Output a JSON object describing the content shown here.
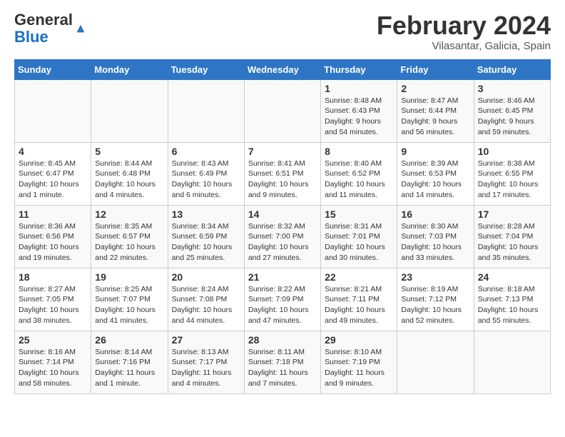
{
  "header": {
    "logo_general": "General",
    "logo_blue": "Blue",
    "title": "February 2024",
    "subtitle": "Vilasantar, Galicia, Spain"
  },
  "days_of_week": [
    "Sunday",
    "Monday",
    "Tuesday",
    "Wednesday",
    "Thursday",
    "Friday",
    "Saturday"
  ],
  "weeks": [
    [
      {
        "num": "",
        "info": ""
      },
      {
        "num": "",
        "info": ""
      },
      {
        "num": "",
        "info": ""
      },
      {
        "num": "",
        "info": ""
      },
      {
        "num": "1",
        "info": "Sunrise: 8:48 AM\nSunset: 6:43 PM\nDaylight: 9 hours\nand 54 minutes."
      },
      {
        "num": "2",
        "info": "Sunrise: 8:47 AM\nSunset: 6:44 PM\nDaylight: 9 hours\nand 56 minutes."
      },
      {
        "num": "3",
        "info": "Sunrise: 8:46 AM\nSunset: 6:45 PM\nDaylight: 9 hours\nand 59 minutes."
      }
    ],
    [
      {
        "num": "4",
        "info": "Sunrise: 8:45 AM\nSunset: 6:47 PM\nDaylight: 10 hours\nand 1 minute."
      },
      {
        "num": "5",
        "info": "Sunrise: 8:44 AM\nSunset: 6:48 PM\nDaylight: 10 hours\nand 4 minutes."
      },
      {
        "num": "6",
        "info": "Sunrise: 8:43 AM\nSunset: 6:49 PM\nDaylight: 10 hours\nand 6 minutes."
      },
      {
        "num": "7",
        "info": "Sunrise: 8:41 AM\nSunset: 6:51 PM\nDaylight: 10 hours\nand 9 minutes."
      },
      {
        "num": "8",
        "info": "Sunrise: 8:40 AM\nSunset: 6:52 PM\nDaylight: 10 hours\nand 11 minutes."
      },
      {
        "num": "9",
        "info": "Sunrise: 8:39 AM\nSunset: 6:53 PM\nDaylight: 10 hours\nand 14 minutes."
      },
      {
        "num": "10",
        "info": "Sunrise: 8:38 AM\nSunset: 6:55 PM\nDaylight: 10 hours\nand 17 minutes."
      }
    ],
    [
      {
        "num": "11",
        "info": "Sunrise: 8:36 AM\nSunset: 6:56 PM\nDaylight: 10 hours\nand 19 minutes."
      },
      {
        "num": "12",
        "info": "Sunrise: 8:35 AM\nSunset: 6:57 PM\nDaylight: 10 hours\nand 22 minutes."
      },
      {
        "num": "13",
        "info": "Sunrise: 8:34 AM\nSunset: 6:59 PM\nDaylight: 10 hours\nand 25 minutes."
      },
      {
        "num": "14",
        "info": "Sunrise: 8:32 AM\nSunset: 7:00 PM\nDaylight: 10 hours\nand 27 minutes."
      },
      {
        "num": "15",
        "info": "Sunrise: 8:31 AM\nSunset: 7:01 PM\nDaylight: 10 hours\nand 30 minutes."
      },
      {
        "num": "16",
        "info": "Sunrise: 8:30 AM\nSunset: 7:03 PM\nDaylight: 10 hours\nand 33 minutes."
      },
      {
        "num": "17",
        "info": "Sunrise: 8:28 AM\nSunset: 7:04 PM\nDaylight: 10 hours\nand 35 minutes."
      }
    ],
    [
      {
        "num": "18",
        "info": "Sunrise: 8:27 AM\nSunset: 7:05 PM\nDaylight: 10 hours\nand 38 minutes."
      },
      {
        "num": "19",
        "info": "Sunrise: 8:25 AM\nSunset: 7:07 PM\nDaylight: 10 hours\nand 41 minutes."
      },
      {
        "num": "20",
        "info": "Sunrise: 8:24 AM\nSunset: 7:08 PM\nDaylight: 10 hours\nand 44 minutes."
      },
      {
        "num": "21",
        "info": "Sunrise: 8:22 AM\nSunset: 7:09 PM\nDaylight: 10 hours\nand 47 minutes."
      },
      {
        "num": "22",
        "info": "Sunrise: 8:21 AM\nSunset: 7:11 PM\nDaylight: 10 hours\nand 49 minutes."
      },
      {
        "num": "23",
        "info": "Sunrise: 8:19 AM\nSunset: 7:12 PM\nDaylight: 10 hours\nand 52 minutes."
      },
      {
        "num": "24",
        "info": "Sunrise: 8:18 AM\nSunset: 7:13 PM\nDaylight: 10 hours\nand 55 minutes."
      }
    ],
    [
      {
        "num": "25",
        "info": "Sunrise: 8:16 AM\nSunset: 7:14 PM\nDaylight: 10 hours\nand 58 minutes."
      },
      {
        "num": "26",
        "info": "Sunrise: 8:14 AM\nSunset: 7:16 PM\nDaylight: 11 hours\nand 1 minute."
      },
      {
        "num": "27",
        "info": "Sunrise: 8:13 AM\nSunset: 7:17 PM\nDaylight: 11 hours\nand 4 minutes."
      },
      {
        "num": "28",
        "info": "Sunrise: 8:11 AM\nSunset: 7:18 PM\nDaylight: 11 hours\nand 7 minutes."
      },
      {
        "num": "29",
        "info": "Sunrise: 8:10 AM\nSunset: 7:19 PM\nDaylight: 11 hours\nand 9 minutes."
      },
      {
        "num": "",
        "info": ""
      },
      {
        "num": "",
        "info": ""
      }
    ]
  ]
}
